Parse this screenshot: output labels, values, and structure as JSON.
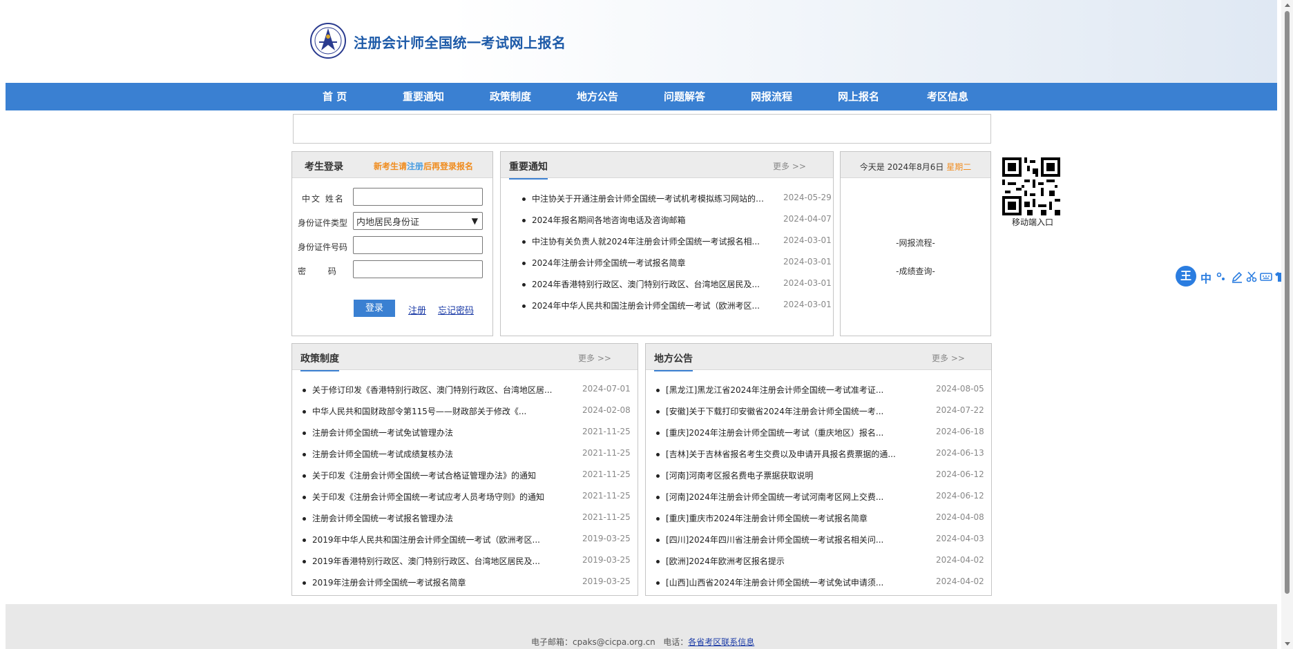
{
  "header": {
    "title": "注册会计师全国统一考试网上报名"
  },
  "nav": {
    "items": [
      {
        "label": "首 页"
      },
      {
        "label": "重要通知"
      },
      {
        "label": "政策制度"
      },
      {
        "label": "地方公告"
      },
      {
        "label": "问题解答"
      },
      {
        "label": "网报流程"
      },
      {
        "label": "网上报名"
      },
      {
        "label": "考区信息"
      }
    ]
  },
  "login": {
    "title": "考生登录",
    "tip_prefix": "新考生请",
    "tip_link": "注册",
    "tip_suffix": "后再登录报名",
    "name_label": "中文 姓名",
    "name_value": "",
    "idtype_label": "身份证件类型",
    "idtype_value": "内地居民身份证",
    "idno_label": "身份证件号码",
    "idno_value": "",
    "password_label": "密 码",
    "password_value": "",
    "login_button": "登录",
    "register_link": "注册",
    "forgot_link": "忘记密码"
  },
  "notices": {
    "title": "重要通知",
    "more": "更多 >>",
    "items": [
      {
        "title": "中注协关于开通注册会计师全国统一考试机考模拟练习网站的公...",
        "date": "2024-05-29"
      },
      {
        "title": "2024年报名期间各地咨询电话及咨询邮箱",
        "date": "2024-04-07"
      },
      {
        "title": "中注协有关负责人就2024年注册会计师全国统一考试报名相...",
        "date": "2024-03-01"
      },
      {
        "title": "2024年注册会计师全国统一考试报名简章",
        "date": "2024-03-01"
      },
      {
        "title": "2024年香港特别行政区、澳门特别行政区、台湾地区居民及...",
        "date": "2024-03-01"
      },
      {
        "title": "2024年中华人民共和国注册会计师全国统一考试（欧洲考区...",
        "date": "2024-03-01"
      }
    ]
  },
  "date_panel": {
    "prefix": "今天是 2024年8月6日",
    "weekday": "星期二",
    "links": [
      "-网报流程-",
      "-成绩查询-"
    ]
  },
  "qr": {
    "label": "移动端入口"
  },
  "policy": {
    "title": "政策制度",
    "more": "更多 >>",
    "items": [
      {
        "title": "关于修订印发《香港特别行政区、澳门特别行政区、台湾地区居...",
        "date": "2024-07-01"
      },
      {
        "title": "中华人民共和国财政部令第115号——财政部关于修改《...",
        "date": "2024-02-08"
      },
      {
        "title": "注册会计师全国统一考试免试管理办法",
        "date": "2021-11-25"
      },
      {
        "title": "注册会计师全国统一考试成绩复核办法",
        "date": "2021-11-25"
      },
      {
        "title": "关于印发《注册会计师全国统一考试合格证管理办法》的通知",
        "date": "2021-11-25"
      },
      {
        "title": "关于印发《注册会计师全国统一考试应考人员考场守则》的通知",
        "date": "2021-11-25"
      },
      {
        "title": "注册会计师全国统一考试报名管理办法",
        "date": "2021-11-25"
      },
      {
        "title": "2019年中华人民共和国注册会计师全国统一考试（欧洲考区...",
        "date": "2019-03-25"
      },
      {
        "title": "2019年香港特别行政区、澳门特别行政区、台湾地区居民及...",
        "date": "2019-03-25"
      },
      {
        "title": "2019年注册会计师全国统一考试报名简章",
        "date": "2019-03-25"
      }
    ]
  },
  "local": {
    "title": "地方公告",
    "more": "更多 >>",
    "items": [
      {
        "title": "[黑龙江]黑龙江省2024年注册会计师全国统一考试准考证...",
        "date": "2024-08-05"
      },
      {
        "title": "[安徽]关于下载打印安徽省2024年注册会计师全国统一考...",
        "date": "2024-07-22"
      },
      {
        "title": "[重庆]2024年注册会计师全国统一考试（重庆地区）报名...",
        "date": "2024-06-18"
      },
      {
        "title": "[吉林]关于吉林省报名考生交费以及申请开具报名费票据的通...",
        "date": "2024-06-13"
      },
      {
        "title": "[河南]河南考区报名费电子票据获取说明",
        "date": "2024-06-12"
      },
      {
        "title": "[河南]2024年注册会计师全国统一考试河南考区网上交费...",
        "date": "2024-06-12"
      },
      {
        "title": "[重庆]重庆市2024年注册会计师全国统一考试报名简章",
        "date": "2024-04-08"
      },
      {
        "title": "[四川]2024年四川省注册会计师全国统一考试报名相关问...",
        "date": "2024-04-03"
      },
      {
        "title": "[欧洲]2024年欧洲考区报名提示",
        "date": "2024-04-02"
      },
      {
        "title": "[山西]山西省2024年注册会计师全国统一考试免试申请须...",
        "date": "2024-04-02"
      }
    ]
  },
  "footer": {
    "email": "电子邮箱：cpaks@cicpa.org.cn",
    "phone_prefix": "电话：",
    "phone_link": "各省考区联系信息"
  },
  "ime": {
    "logo": "王",
    "mode": "中"
  },
  "colors": {
    "nav_bg": "#3a80d2",
    "accent_orange": "#f08c1e",
    "title_blue": "#1d5aa8",
    "link_blue": "#1a3aa6"
  }
}
